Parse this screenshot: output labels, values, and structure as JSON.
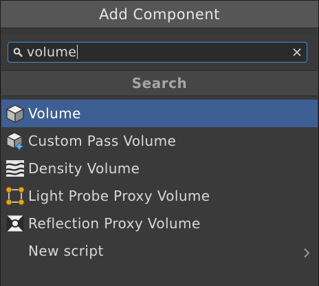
{
  "header": {
    "title": "Add Component"
  },
  "search": {
    "value": "volume",
    "search_icon": "search-icon",
    "clear_icon": "close-icon"
  },
  "section": {
    "title": "Search"
  },
  "items": [
    {
      "label": "Volume",
      "icon": "cube-icon",
      "selected": true
    },
    {
      "label": "Custom Pass Volume",
      "icon": "cube-plus-icon",
      "selected": false
    },
    {
      "label": "Density Volume",
      "icon": "fog-icon",
      "selected": false
    },
    {
      "label": "Light Probe Proxy Volume",
      "icon": "light-probe-icon",
      "selected": false
    },
    {
      "label": "Reflection Proxy Volume",
      "icon": "reflection-icon",
      "selected": false
    },
    {
      "label": "New script",
      "icon": "",
      "selected": false,
      "has_submenu": true
    }
  ],
  "colors": {
    "selected_row": "#3d5f94",
    "focus_border": "#3b8ed6",
    "probe_accent": "#e8a41c"
  }
}
